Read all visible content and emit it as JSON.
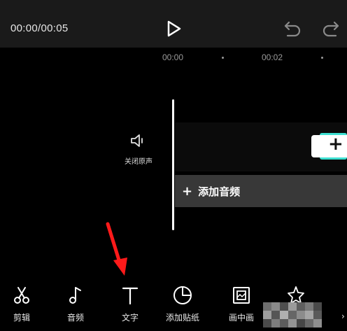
{
  "header": {
    "timecode": "00:00/00:05"
  },
  "ruler": {
    "labels": [
      "00:00",
      "00:02"
    ]
  },
  "timeline": {
    "mute_label": "关闭原声",
    "add_audio_label": "添加音频"
  },
  "toolbar": {
    "items": [
      {
        "label": "剪辑",
        "icon": "scissors-icon"
      },
      {
        "label": "音频",
        "icon": "music-note-icon"
      },
      {
        "label": "文字",
        "icon": "text-icon"
      },
      {
        "label": "添加贴纸",
        "icon": "sticker-icon"
      },
      {
        "label": "画中画",
        "icon": "picture-in-picture-icon"
      },
      {
        "label": "",
        "icon": "effects-icon"
      }
    ]
  },
  "colors": {
    "accent": "#3ee0d2",
    "annotation_arrow": "#ff1a1a"
  }
}
